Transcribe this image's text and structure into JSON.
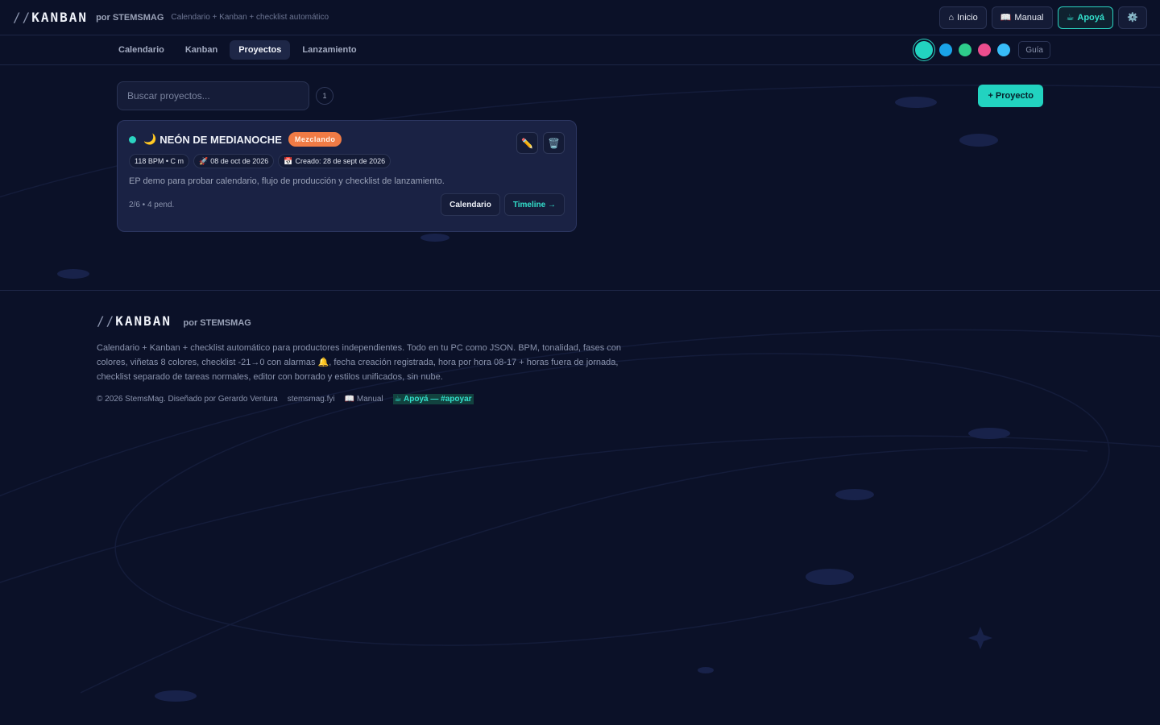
{
  "header": {
    "logo_slashes": "//",
    "logo_text": "KANBAN",
    "by": "por STEMSMAG",
    "tagline": "Calendario + Kanban + checklist automático",
    "buttons": {
      "inicio": "Inicio",
      "manual": "Manual",
      "apoya": "Apoyá"
    }
  },
  "nav": {
    "tabs": [
      {
        "label": "Calendario"
      },
      {
        "label": "Kanban"
      },
      {
        "label": "Proyectos"
      },
      {
        "label": "Lanzamiento"
      }
    ],
    "active_tab": "Proyectos",
    "theme_colors": [
      "#22d3c0",
      "#1aa3e8",
      "#2ecc8b",
      "#ec4d8e",
      "#38bdf8"
    ],
    "guide_label": "Guía"
  },
  "main": {
    "search_placeholder": "Buscar proyectos...",
    "project_count": "1",
    "new_project_label": "+ Proyecto"
  },
  "project": {
    "emoji": "🌙",
    "name": "NEÓN DE MEDIANOCHE",
    "phase": "Mezclando",
    "status_color": "#2bd3c1",
    "chips": {
      "bpm_key": "118 BPM • C m",
      "release": "08 de oct de 2026",
      "created": "Creado: 28 de sept de 2026"
    },
    "description": "EP demo para probar calendario, flujo de producción y checklist de lanzamiento.",
    "progress": "2/6 • 4 pend.",
    "calendar_label": "Calendario",
    "timeline_label": "Timeline →"
  },
  "footer": {
    "logo_slashes": "//",
    "logo_text": "KANBAN",
    "by": "por STEMSMAG",
    "description": "Calendario + Kanban + checklist automático para productores independientes. Todo en tu PC como JSON. BPM, tonalidad, fases con colores, viñetas 8 colores, checklist -21→0 con alarmas 🔔, fecha creación registrada, hora por hora 08-17 + horas fuera de jornada, checklist separado de tareas normales, editor con borrado y estilos unificados, sin nube.",
    "copyright": "© 2026 StemsMag. Diseñado por Gerardo Ventura",
    "site": "stemsmag.fyi",
    "manual": "Manual",
    "apoya": "Apoyá — #apoyar"
  }
}
